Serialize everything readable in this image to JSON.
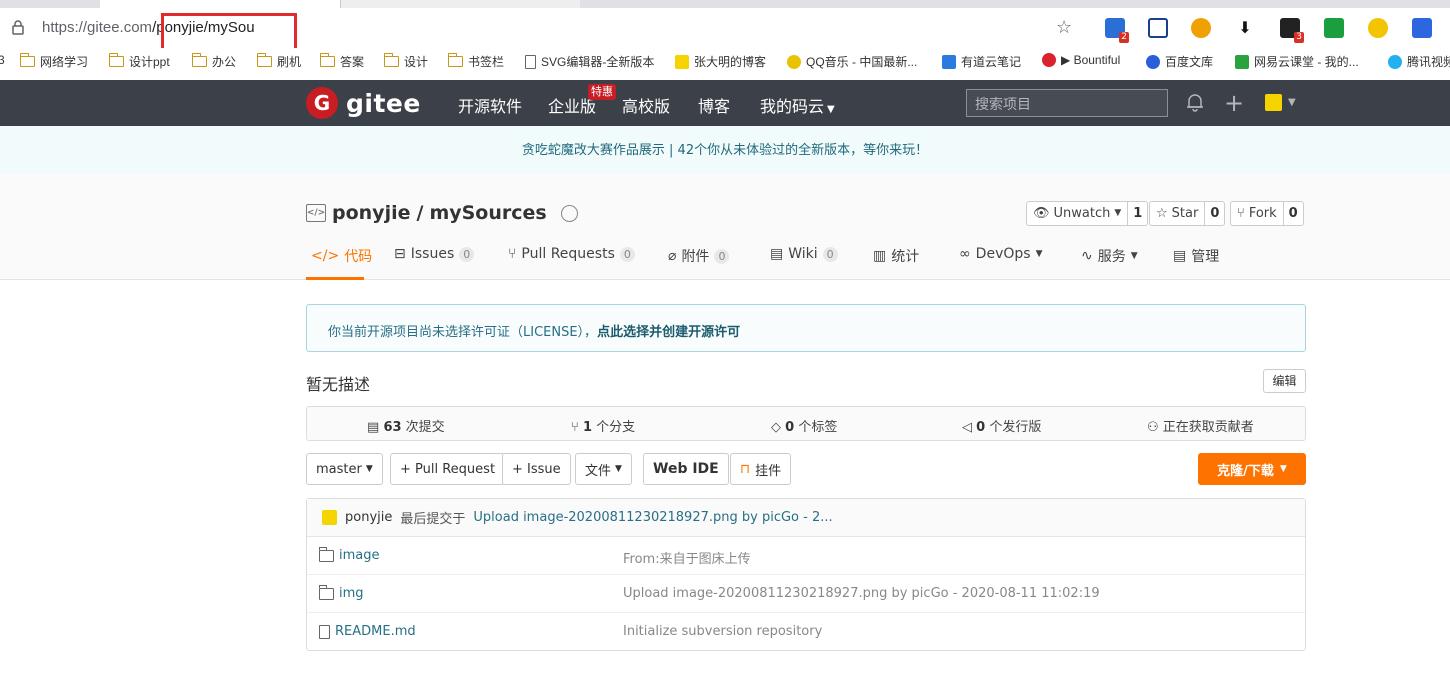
{
  "browser": {
    "url_prefix": "https://gitee.com",
    "url_path": "/ponyjie/mySou",
    "bookmarks": [
      "网络学习",
      "设计ppt",
      "办公",
      "刷机",
      "答案",
      "设计",
      "书签栏",
      "SVG编辑器-全新版本",
      "张大明的博客",
      "QQ音乐 - 中国最新...",
      "有道云笔记",
      "▶ Bountiful",
      "百度文库",
      "网易云课堂 - 我的...",
      "腾讯视频"
    ],
    "extension_badges": [
      "2",
      "3"
    ]
  },
  "header": {
    "logo_letter": "G",
    "logo_text": "gitee",
    "nav": [
      "开源软件",
      "企业版",
      "高校版",
      "博客",
      "我的码云"
    ],
    "promo_badge": "特惠",
    "search_placeholder": "搜索项目"
  },
  "banner": {
    "text": "贪吃蛇魔改大赛作品展示 | 42个你从未体验过的全新版本，等你来玩！"
  },
  "repo": {
    "owner": "ponyjie",
    "separator": "/",
    "name": "mySources",
    "watch_label": "Unwatch",
    "watch_count": "1",
    "star_label": "Star",
    "star_count": "0",
    "fork_label": "Fork",
    "fork_count": "0"
  },
  "tabs": [
    {
      "label": "代码"
    },
    {
      "label": "Issues",
      "count": "0"
    },
    {
      "label": "Pull Requests",
      "count": "0"
    },
    {
      "label": "附件",
      "count": "0"
    },
    {
      "label": "Wiki",
      "count": "0"
    },
    {
      "label": "统计"
    },
    {
      "label": "DevOps"
    },
    {
      "label": "服务"
    },
    {
      "label": "管理"
    }
  ],
  "license": {
    "text": "你当前开源项目尚未选择许可证（LICENSE），",
    "link": "点此选择并创建开源许可"
  },
  "description": {
    "text": "暂无描述",
    "edit_label": "编辑"
  },
  "stats": {
    "commits_num": "63",
    "commits_label": "次提交",
    "branches_num": "1",
    "branches_label": "个分支",
    "tags_num": "0",
    "tags_label": "个标签",
    "releases_num": "0",
    "releases_label": "个发行版",
    "contributors_label": "正在获取贡献者"
  },
  "toolbar": {
    "branch": "master",
    "pull_request": "+ Pull Request",
    "issue": "+ Issue",
    "file": "文件",
    "webide": "Web IDE",
    "widget": "挂件",
    "clone": "克隆/下载"
  },
  "commit": {
    "user": "ponyjie",
    "label": "最后提交于",
    "message": "Upload image-20200811230218927.png by picGo - 2..."
  },
  "files": [
    {
      "name": "image",
      "type": "folder",
      "message": "From:来自于图床上传"
    },
    {
      "name": "img",
      "type": "folder",
      "message": "Upload image-20200811230218927.png by picGo - 2020-08-11 11:02:19"
    },
    {
      "name": "README.md",
      "type": "file",
      "message": "Initialize subversion repository"
    }
  ]
}
